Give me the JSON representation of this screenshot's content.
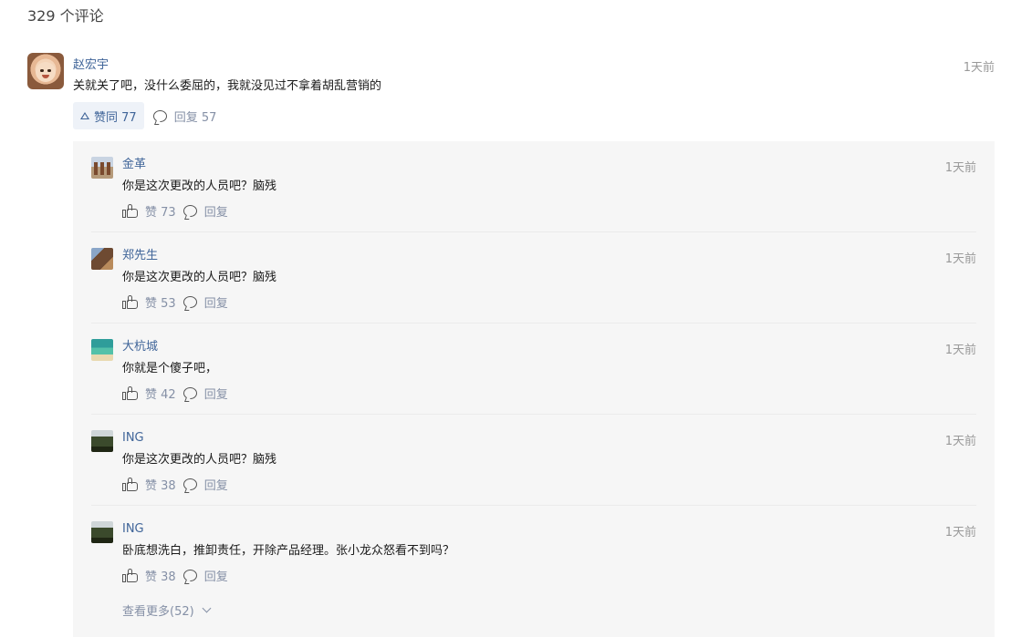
{
  "header": {
    "comment_count": "329 个评论"
  },
  "main_comment": {
    "author": "赵宏宇",
    "time": "1天前",
    "text": "关就关了吧，没什么委屈的，我就没见过不拿着胡乱营销的",
    "vote_label": "赞同 77",
    "reply_label": "回复 57"
  },
  "replies": [
    {
      "author": "金革",
      "time": "1天前",
      "text": "你是这次更改的人员吧？脑残",
      "like_label": "赞 73",
      "reply_label": "回复",
      "avatar_icon": "avatar-figures"
    },
    {
      "author": "郑先生",
      "time": "1天前",
      "text": "你是这次更改的人员吧？脑残",
      "like_label": "赞 53",
      "reply_label": "回复",
      "avatar_icon": "avatar-horse"
    },
    {
      "author": "大杭城",
      "time": "1天前",
      "text": "你就是个傻子吧，",
      "like_label": "赞 42",
      "reply_label": "回复",
      "avatar_icon": "avatar-sea"
    },
    {
      "author": "ING",
      "time": "1天前",
      "text": "你是这次更改的人员吧？脑残",
      "like_label": "赞 38",
      "reply_label": "回复",
      "avatar_icon": "avatar-landscape"
    },
    {
      "author": "ING",
      "time": "1天前",
      "text": "卧底想洗白，推卸责任，开除产品经理。张小龙众怒看不到吗？",
      "like_label": "赞 38",
      "reply_label": "回复",
      "avatar_icon": "avatar-landscape"
    }
  ],
  "more": {
    "label": "查看更多(52)"
  },
  "colors": {
    "author": "#406599",
    "meta": "#8590a6",
    "panel_bg": "#f6f6f6",
    "vote_bg": "#eef2f8"
  }
}
